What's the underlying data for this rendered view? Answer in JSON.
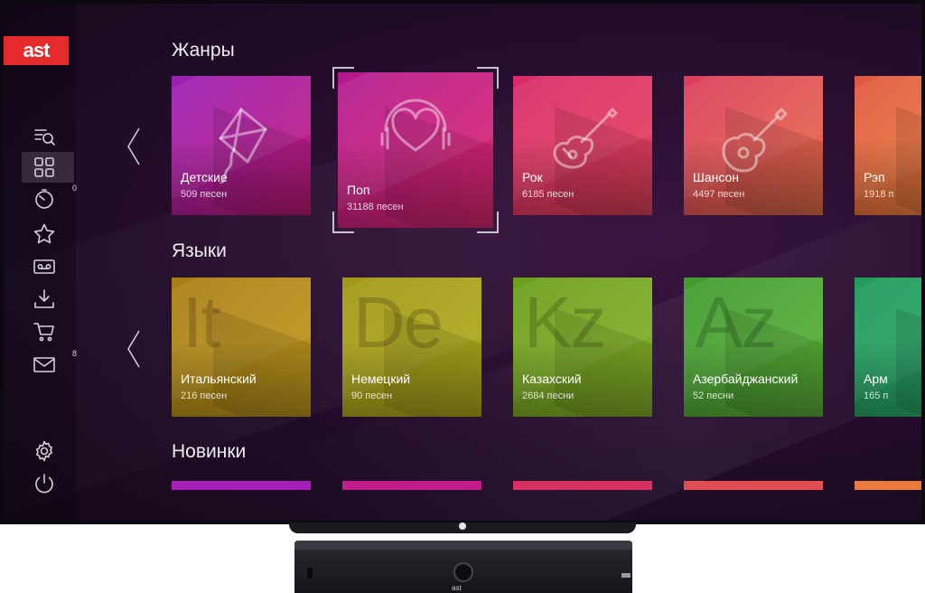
{
  "brand": {
    "logo_text": "ast",
    "box_label": "ast"
  },
  "sidebar": {
    "items": [
      {
        "name": "search-list",
        "icon": "search-list-icon",
        "badge": ""
      },
      {
        "name": "catalog-grid",
        "icon": "grid-icon",
        "badge": "",
        "active": true
      },
      {
        "name": "history",
        "icon": "timer-icon",
        "badge": "0"
      },
      {
        "name": "favorites",
        "icon": "star-icon",
        "badge": ""
      },
      {
        "name": "cassette",
        "icon": "cassette-icon",
        "badge": ""
      },
      {
        "name": "downloads",
        "icon": "download-icon",
        "badge": ""
      },
      {
        "name": "cart",
        "icon": "cart-icon",
        "badge": ""
      },
      {
        "name": "messages",
        "icon": "mail-icon",
        "badge": "8"
      },
      {
        "name": "settings",
        "icon": "gear-icon",
        "badge": ""
      },
      {
        "name": "power",
        "icon": "power-icon",
        "badge": ""
      }
    ]
  },
  "sections": {
    "genres": {
      "title": "Жанры",
      "tiles": [
        {
          "name": "Детские",
          "count": "509 песен",
          "icon": "kite-icon",
          "colors": [
            "#9b1fb5",
            "#c31a78"
          ]
        },
        {
          "name": "Поп",
          "count": "31188 песен",
          "icon": "heart-headphones-icon",
          "colors": [
            "#b2188f",
            "#e0286e"
          ],
          "focused": true
        },
        {
          "name": "Рок",
          "count": "6185 песен",
          "icon": "electric-guitar-icon",
          "colors": [
            "#d92a6a",
            "#e6455a"
          ]
        },
        {
          "name": "Шансон",
          "count": "4497 песен",
          "icon": "acoustic-guitar-icon",
          "colors": [
            "#db3c5b",
            "#e8704a"
          ]
        },
        {
          "name": "Рэп",
          "count": "1918 п",
          "icon": "",
          "colors": [
            "#e0573f",
            "#ef8a3a"
          ]
        }
      ]
    },
    "languages": {
      "title": "Языки",
      "tiles": [
        {
          "name": "Итальянский",
          "count": "216 песен",
          "letters": "It",
          "colors": [
            "#a87d12",
            "#c39b1e"
          ]
        },
        {
          "name": "Немецкий",
          "count": "90 песен",
          "letters": "De",
          "colors": [
            "#a19713",
            "#b3ae1f"
          ]
        },
        {
          "name": "Казахский",
          "count": "2684 песни",
          "letters": "Kz",
          "colors": [
            "#6a9e1a",
            "#86b32a"
          ]
        },
        {
          "name": "Азербайджанский",
          "count": "52 песни",
          "letters": "Az",
          "colors": [
            "#3e9b2e",
            "#5fb33a"
          ]
        },
        {
          "name": "Арм",
          "count": "165 п",
          "letters": "",
          "colors": [
            "#1f9b5a",
            "#2aa86a"
          ]
        }
      ]
    },
    "new": {
      "title": "Новинки",
      "strips": [
        "#a71fb6",
        "#c41b8c",
        "#d93064",
        "#e04d52",
        "#e87a3e"
      ]
    }
  }
}
